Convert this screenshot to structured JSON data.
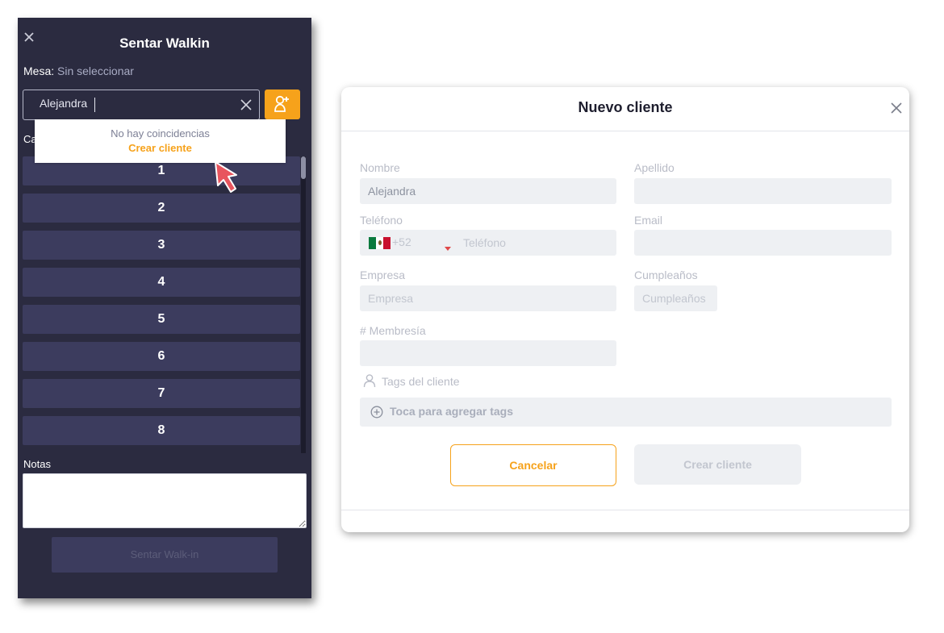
{
  "walkin_panel": {
    "title": "Sentar Walkin",
    "mesa_label": "Mesa:",
    "mesa_value": "Sin seleccionar",
    "search_value": "Alejandra",
    "dropdown_no_match": "No hay coincidencias",
    "dropdown_create": "Crear cliente",
    "partial_label": "Ca",
    "tables": [
      "1",
      "2",
      "3",
      "4",
      "5",
      "6",
      "7",
      "8"
    ],
    "notes_label": "Notas",
    "notes_value": "",
    "submit_label": "Sentar Walk-in"
  },
  "new_client_modal": {
    "title": "Nuevo cliente",
    "nombre_label": "Nombre",
    "nombre_value": "Alejandra",
    "apellido_label": "Apellido",
    "apellido_value": "",
    "telefono_label": "Teléfono",
    "telefono_country_code": "+52",
    "telefono_placeholder": "Teléfono",
    "email_label": "Email",
    "email_value": "",
    "empresa_label": "Empresa",
    "empresa_placeholder": "Empresa",
    "cumpleanos_label": "Cumpleaños",
    "cumpleanos_placeholder": "Cumpleaños",
    "membresia_label": "# Membresía",
    "membresia_value": "",
    "tags_label": "Tags del cliente",
    "tags_add_label": "Toca para agregar tags",
    "cancel_label": "Cancelar",
    "create_label": "Crear cliente"
  },
  "colors": {
    "accent": "#f6a21b",
    "panel_bg": "#2b2b40",
    "table_button_bg": "#3c3c5e",
    "field_bg": "#eef0f3",
    "cursor": "#e8555e"
  },
  "icons": [
    "close-icon",
    "clear-icon",
    "add-user-icon",
    "cursor-arrow-icon",
    "mexico-flag-icon",
    "user-icon",
    "plus-circle-icon"
  ]
}
